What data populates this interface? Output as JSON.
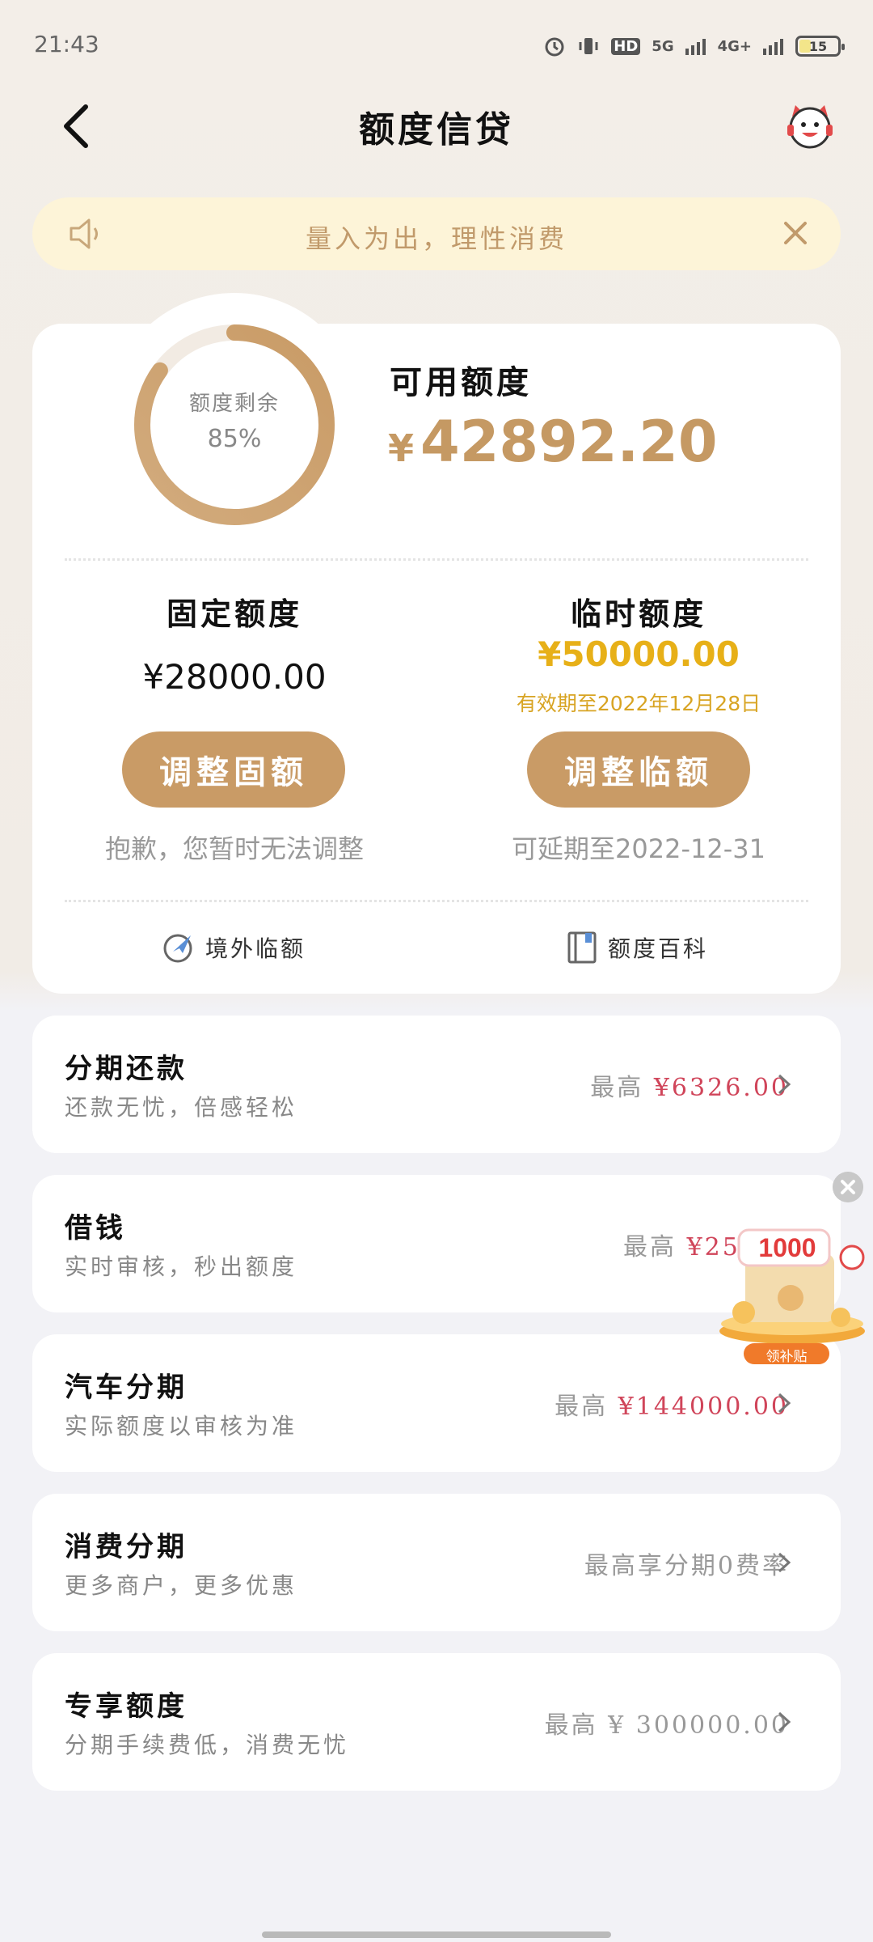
{
  "status": {
    "time": "21:43",
    "hd_label": "HD",
    "signal_5g": "5G",
    "signal_4g": "4G+",
    "battery_level": "15"
  },
  "header": {
    "title": "额度信贷"
  },
  "notice": {
    "text": "量入为出，理性消费"
  },
  "quota": {
    "ring_label": "额度剩余",
    "ring_percent_text": "85%",
    "ring_fraction": 0.85,
    "available_label": "可用额度",
    "available_currency": "¥",
    "available_amount": "42892.20",
    "fixed": {
      "title": "固定额度",
      "amount": "¥28000.00",
      "button": "调整固额",
      "note": "抱歉，您暂时无法调整"
    },
    "temporary": {
      "title": "临时额度",
      "amount": "¥50000.00",
      "validity": "有效期至2022年12月28日",
      "button": "调整临额",
      "note": "可延期至2022-12-31"
    },
    "links": [
      {
        "label": "境外临额"
      },
      {
        "label": "额度百科"
      }
    ]
  },
  "rows": [
    {
      "title": "分期还款",
      "subtitle": "还款无忧，倍感轻松",
      "right_prefix": "最高 ",
      "right_value": "¥6326.00"
    },
    {
      "title": "借钱",
      "subtitle": "实时审核，秒出额度",
      "right_prefix": "最高 ",
      "right_value": "¥2500"
    },
    {
      "title": "汽车分期",
      "subtitle": "实际额度以审核为准",
      "right_prefix": "最高 ",
      "right_value": "¥144000.00"
    },
    {
      "title": "消费分期",
      "subtitle": "更多商户，更多优惠",
      "right_text": "最高享分期0费率"
    },
    {
      "title": "专享额度",
      "subtitle": "分期手续费低，消费无忧",
      "right_text": "最高 ¥ 300000.00"
    }
  ],
  "float_ad": {
    "amount": "1000",
    "badge": "领补贴"
  },
  "colors": {
    "accent": "#c99b66",
    "gold": "#e7b018",
    "red": "#d0455a",
    "notice_bg": "#fdf4d8"
  }
}
